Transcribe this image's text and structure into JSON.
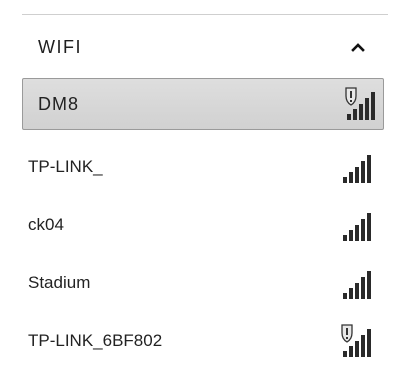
{
  "panel": {
    "section_title": "WIFI",
    "collapse_icon": "chevron-up-icon"
  },
  "networks": [
    {
      "name": "DM8",
      "selected": true,
      "secured": true,
      "signal_bars": 5,
      "icon": "wifi-signal-secured-icon"
    },
    {
      "name": "TP-LINK_",
      "selected": false,
      "secured": false,
      "signal_bars": 5,
      "icon": "wifi-signal-icon"
    },
    {
      "name": "ck04",
      "selected": false,
      "secured": false,
      "signal_bars": 5,
      "icon": "wifi-signal-icon"
    },
    {
      "name": "Stadium",
      "selected": false,
      "secured": false,
      "signal_bars": 5,
      "icon": "wifi-signal-icon"
    },
    {
      "name": "TP-LINK_6BF802",
      "selected": false,
      "secured": true,
      "signal_bars": 5,
      "icon": "wifi-signal-secured-icon"
    }
  ],
  "colors": {
    "selected_background": "#d6d6d6",
    "selected_border": "#9a9a9a",
    "signal_bar": "#2a2a2a"
  }
}
